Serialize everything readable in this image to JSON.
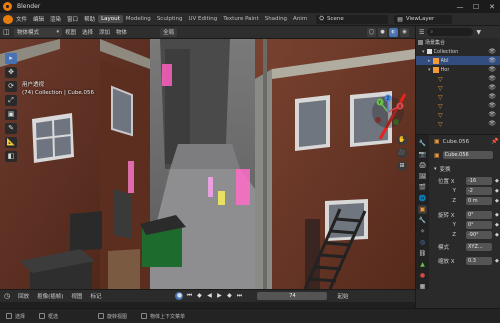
{
  "app": {
    "title": "Blender",
    "accent": "#e87d0d"
  },
  "window": {
    "minimize": "—",
    "maximize": "☐",
    "close": "✕"
  },
  "menu": {
    "items": [
      "文件",
      "编辑",
      "渲染",
      "窗口",
      "帮助"
    ],
    "workspaces": [
      "Layout",
      "Modeling",
      "Sculpting",
      "UV Editing",
      "Texture Paint",
      "Shading",
      "Anim"
    ],
    "active_workspace": "Layout",
    "scene_label": "Scene",
    "viewlayer_label": "ViewLayer"
  },
  "toolbar": {
    "mode": "物体模式",
    "items": [
      "视图",
      "选择",
      "添加",
      "物体"
    ],
    "global": "全局"
  },
  "viewport": {
    "view_name": "用户透视",
    "collection_info": "(74) Collection | Cube.056",
    "tools": [
      "▸",
      "✥",
      "⟳",
      "⤢",
      "▣",
      "✎",
      "📐",
      "◧"
    ],
    "nav_buttons": [
      "✋",
      "🎥",
      "⊞"
    ],
    "gizmo": {
      "x": "X",
      "y": "Y",
      "z": "Z"
    }
  },
  "outliner": {
    "search_placeholder": "",
    "rows": [
      {
        "label": "场景集合",
        "level": 0
      },
      {
        "label": "Collection",
        "level": 1
      },
      {
        "label": "Abl",
        "level": 2
      },
      {
        "label": "Hor",
        "level": 2
      },
      {
        "label": "",
        "level": 3
      },
      {
        "label": "",
        "level": 3
      },
      {
        "label": "",
        "level": 3
      },
      {
        "label": "",
        "level": 3
      },
      {
        "label": "",
        "level": 3
      },
      {
        "label": "",
        "level": 3
      }
    ]
  },
  "properties": {
    "object_name": "Cube.056",
    "data_name": "Cube.056",
    "section": "变换",
    "location": {
      "label": "位置 X",
      "x": "-16",
      "y": "-2",
      "z": "0 m"
    },
    "rotation": {
      "label": "旋转 X",
      "x": "0°",
      "y": "0°",
      "z": "-90°"
    },
    "mode_label": "模式",
    "mode_value": "XYZ...",
    "scale": {
      "label": "缩放 X",
      "x": "0.3"
    },
    "axis_y": "Y",
    "axis_z": "Z"
  },
  "timeline": {
    "items": [
      "回放",
      "抠像(插帧)",
      "视图",
      "标记"
    ],
    "frame": "74",
    "start_label": "起始"
  },
  "status": {
    "items": [
      "选择",
      "框选",
      "旋转视图",
      "物体上下文菜单"
    ]
  }
}
